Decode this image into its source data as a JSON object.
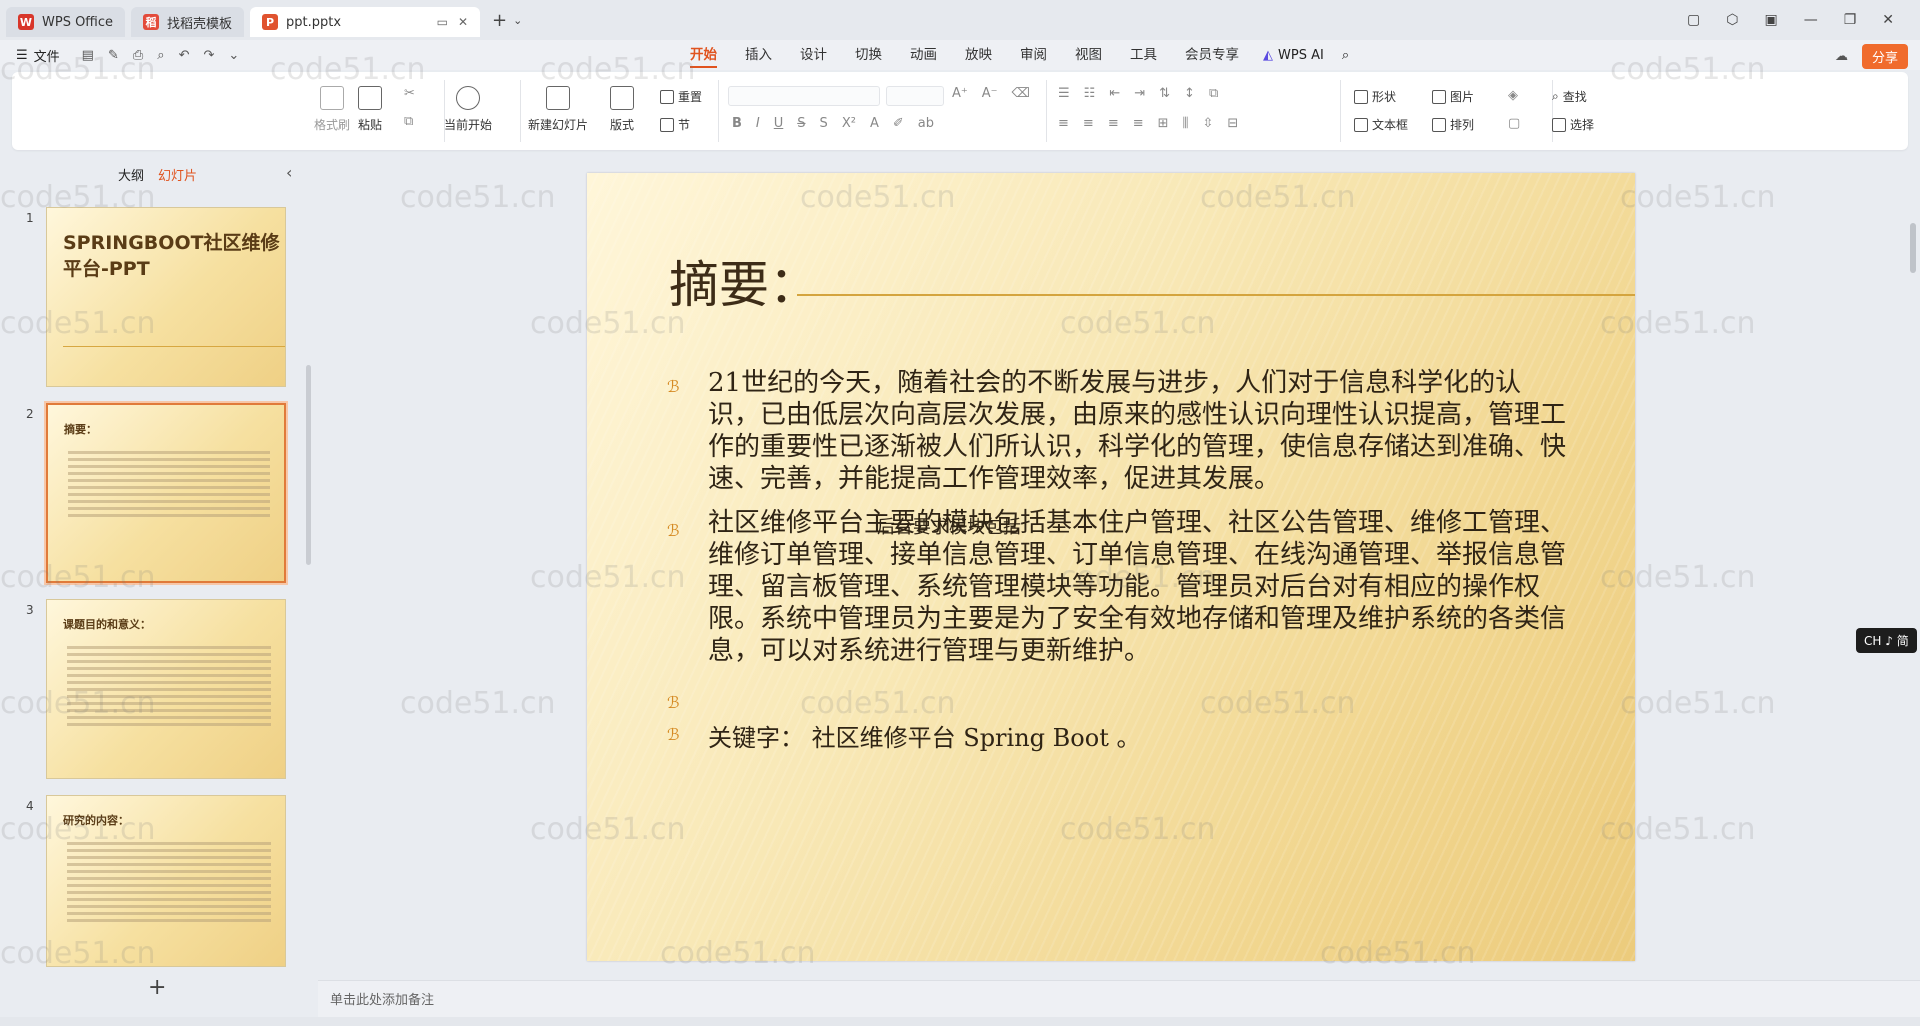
{
  "titlebar": {
    "tabs": [
      {
        "label": "WPS Office",
        "icon": "wps-logo-icon"
      },
      {
        "label": "找稻壳模板",
        "icon": "docer-icon"
      },
      {
        "label": "ppt.pptx",
        "icon": "ppt-file-icon"
      }
    ]
  },
  "menubar": {
    "file": "文件",
    "menus": [
      "开始",
      "插入",
      "设计",
      "切换",
      "动画",
      "放映",
      "审阅",
      "视图",
      "工具",
      "会员专享"
    ],
    "active_menu": "开始",
    "wps_ai": "WPS AI",
    "share": "分享"
  },
  "ribbon": {
    "format_painter": "格式刷",
    "paste": "粘贴",
    "play_current": "当前开始",
    "new_slide": "新建幻灯片",
    "layout": "版式",
    "reset": "重置",
    "section": "节",
    "shape": "形状",
    "picture": "图片",
    "textbox": "文本框",
    "arrange": "排列",
    "find": "查找",
    "select": "选择"
  },
  "leftpanel": {
    "tab_outline": "大纲",
    "tab_slides": "幻灯片",
    "slides": [
      {
        "num": "1",
        "title": "SPRINGBOOT社区维修平台-PPT"
      },
      {
        "num": "2",
        "title": "摘要："
      },
      {
        "num": "3",
        "title": "课题目的和意义："
      },
      {
        "num": "4",
        "title": "研究的内容："
      }
    ],
    "add": "+"
  },
  "slide": {
    "title": "摘要：",
    "paragraph1": "21世纪的今天，随着社会的不断发展与进步，人们对于信息科学化的认识，已由低层次向高层次发展，由原来的感性认识向理性认识提高，管理工作的重要性已逐渐被人们所认识，科学化的管理，使信息存储达到准确、快速、完善，并能提高工作管理效率，促进其发展。",
    "paragraph2": " 社区维修平台主要的模块包括基本住户管理、社区公告管理、维修工管理、维修订单管理、接单信息管理、订单信息管理、在线沟通管理、举报信息管理、留言板管理、系统管理模块等功能。管理员对后台对有相应的操作权限。系统中管理员为主要是为了安全有效地存储和管理及维护系统的各类信息，可以对系统进行管理与更新维护。",
    "overlap_text": "后台要求模块包括",
    "keywords": "关键字： 社区维修平台 Spring Boot 。"
  },
  "ime": "CH ♪ 简",
  "notes_placeholder": "单击此处添加备注",
  "watermark": "code51.cn",
  "colors": {
    "accent": "#e0531f",
    "share": "#f06b2c",
    "slide_gold": "#f1d68f"
  }
}
